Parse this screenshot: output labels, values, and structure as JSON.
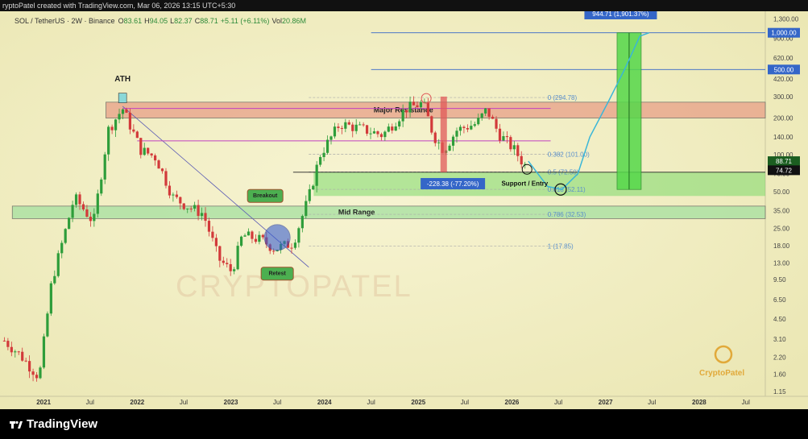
{
  "header": {
    "created_by": "ryptoPatel created with TradingView.com, Mar 06, 2026 13:15 UTC+5:30"
  },
  "legend": {
    "symbol": "SOL / TetherUS · 2W · Binance",
    "o_label": "O",
    "o": "83.61",
    "h_label": "H",
    "h": "94.05",
    "l_label": "L",
    "l": "82.37",
    "c_label": "C",
    "c": "88.71",
    "change": "+5.11 (+6.11%)",
    "vol_label": "Vol",
    "vol": "20.86M"
  },
  "footer": {
    "brand": "TradingView"
  },
  "watermark": {
    "logo_text": "CryptoPatel",
    "big_text": "CRYPTOPATEL"
  },
  "colors": {
    "up": "#2e9d3a",
    "down": "#d23a3a",
    "bg": "#f5f2cc",
    "resistance": "#e8a088",
    "accent_blue": "#3466c8",
    "green_zone": "#55d84a",
    "projection": "#3ab6d8"
  },
  "chart_data": {
    "type": "candlestick",
    "scale": "log",
    "ylim": [
      1.05,
      1500
    ],
    "xlim": [
      "2020-07-15",
      "2028-09-15"
    ],
    "x_ticks": [
      "2021",
      "Jul",
      "2022",
      "Jul",
      "2023",
      "Jul",
      "2024",
      "Jul",
      "2025",
      "Jul",
      "2026",
      "Jul",
      "2027",
      "Jul",
      "2028",
      "Jul"
    ],
    "x_tick_dates": [
      "2021-01-01",
      "2021-07-01",
      "2022-01-01",
      "2022-07-01",
      "2023-01-01",
      "2023-07-01",
      "2024-01-01",
      "2024-07-01",
      "2025-01-01",
      "2025-07-01",
      "2026-01-01",
      "2026-07-01",
      "2027-01-01",
      "2027-07-01",
      "2028-01-01",
      "2028-07-01"
    ],
    "y_ticks": [
      "1,300.00",
      "900.00",
      "620.00",
      "420.00",
      "300.00",
      "200.00",
      "140.00",
      "100.00",
      "70.00",
      "50.00",
      "35.00",
      "25.00",
      "18.00",
      "13.00",
      "9.50",
      "6.50",
      "4.50",
      "3.10",
      "2.20",
      "1.60",
      "1.15"
    ],
    "y_tick_values": [
      1300,
      900,
      620,
      420,
      300,
      200,
      140,
      100,
      70,
      50,
      35,
      25,
      18,
      13,
      9.5,
      6.5,
      4.5,
      3.1,
      2.2,
      1.6,
      1.15
    ],
    "price_tags": [
      {
        "label": "1,000.00",
        "value": 1000,
        "color": "#3466c8"
      },
      {
        "label": "500.00",
        "value": 500,
        "color": "#3466c8"
      },
      {
        "label": "88.71",
        "value": 88.71,
        "color": "#1b5e20"
      },
      {
        "label": "74.72",
        "value": 74.72,
        "color": "#111111"
      }
    ],
    "anchors": [
      [
        "2020-08-01",
        3.0
      ],
      [
        "2020-10-01",
        2.3
      ],
      [
        "2020-12-15",
        1.5
      ],
      [
        "2021-02-01",
        9
      ],
      [
        "2021-05-01",
        45
      ],
      [
        "2021-07-15",
        28
      ],
      [
        "2021-09-10",
        160
      ],
      [
        "2021-11-05",
        240
      ],
      [
        "2022-01-15",
        110
      ],
      [
        "2022-03-15",
        95
      ],
      [
        "2022-05-20",
        45
      ],
      [
        "2022-07-15",
        38
      ],
      [
        "2022-09-15",
        33
      ],
      [
        "2022-11-15",
        14
      ],
      [
        "2023-01-05",
        11
      ],
      [
        "2023-02-15",
        22
      ],
      [
        "2023-05-01",
        20
      ],
      [
        "2023-06-20",
        17
      ],
      [
        "2023-09-01",
        19
      ],
      [
        "2023-11-01",
        45
      ],
      [
        "2023-12-15",
        100
      ],
      [
        "2024-03-01",
        180
      ],
      [
        "2024-05-15",
        165
      ],
      [
        "2024-08-15",
        145
      ],
      [
        "2024-11-15",
        240
      ],
      [
        "2025-01-20",
        265
      ],
      [
        "2025-03-01",
        145
      ],
      [
        "2025-04-10",
        110
      ],
      [
        "2025-06-01",
        160
      ],
      [
        "2025-08-15",
        180
      ],
      [
        "2025-09-25",
        235
      ],
      [
        "2025-11-10",
        150
      ],
      [
        "2026-01-10",
        110
      ],
      [
        "2026-02-20",
        82
      ],
      [
        "2026-03-06",
        88.71
      ]
    ],
    "projection": [
      [
        "2026-03-06",
        88.71
      ],
      [
        "2026-05-20",
        55
      ],
      [
        "2026-07-15",
        52
      ],
      [
        "2026-09-15",
        70
      ],
      [
        "2026-11-01",
        140
      ],
      [
        "2027-01-15",
        280
      ],
      [
        "2027-03-20",
        520
      ],
      [
        "2027-05-15",
        940
      ],
      [
        "2027-06-20",
        1000
      ]
    ],
    "fib_levels": [
      {
        "label": "0 (294.78)",
        "value": 294.78
      },
      {
        "label": "0.382 (101.00)",
        "value": 101
      },
      {
        "label": "0.5 (72.50)",
        "value": 72.5
      },
      {
        "label": "0.618 (52.11)",
        "value": 52.11
      },
      {
        "label": "0.786 (32.53)",
        "value": 32.53
      },
      {
        "label": "1 (17.85)",
        "value": 17.85
      }
    ],
    "zones": [
      {
        "label": "Major Resistance",
        "from": "2021-09-01",
        "to": "2028-09-15",
        "low": 200,
        "high": 270,
        "color": "#e8a088"
      },
      {
        "label": "Mid Range",
        "from": "2020-09-01",
        "to": "2028-09-15",
        "low": 30,
        "high": 38,
        "color": "#a5e0a0"
      },
      {
        "label": "",
        "from": "2023-11-20",
        "to": "2028-09-15",
        "low": 46,
        "high": 72,
        "color": "#7bd86a"
      }
    ],
    "annotations": {
      "ath": "ATH",
      "breakout": "Breakout",
      "retest": "Retest",
      "support": "Support / Entry",
      "drawdown": "-228.38 (-77.20%)",
      "target": "944.71 (1,901.37%)"
    }
  }
}
